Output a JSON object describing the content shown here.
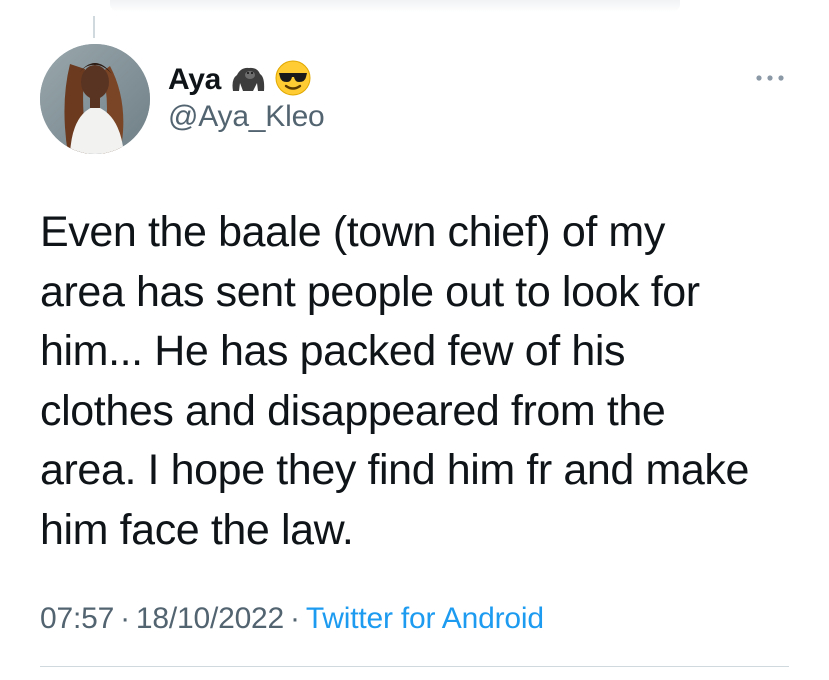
{
  "tweet": {
    "author": {
      "display_name": "Aya",
      "emojis": [
        "gorilla-icon",
        "sunglasses-face-icon"
      ],
      "handle": "@Aya_Kleo"
    },
    "text_lines": [
      "Even the baale (town chief) of my",
      "area has sent people out to look for",
      "him... He has packed few of his",
      "clothes and disappeared from the",
      "area. I hope they find him fr and make",
      "him face the law."
    ],
    "time": "07:57",
    "date": "18/10/2022",
    "source": "Twitter for Android",
    "separator": "·"
  },
  "colors": {
    "text": "#0f1419",
    "secondary": "#536471",
    "link": "#1d9bf0",
    "divider": "#cfd9de"
  }
}
